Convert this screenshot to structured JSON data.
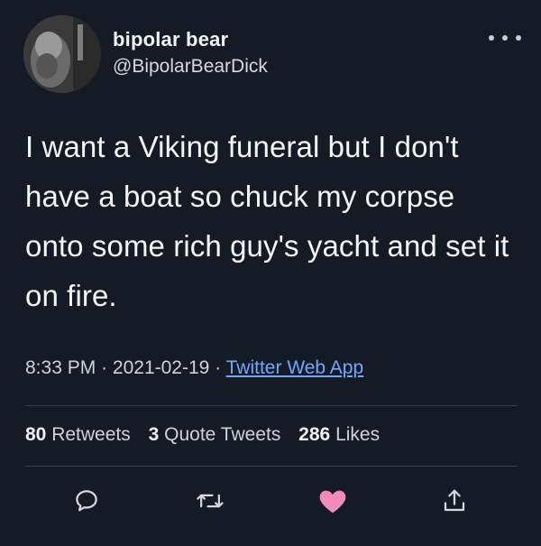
{
  "author": {
    "display_name": "bipolar bear",
    "handle": "@BipolarBearDick"
  },
  "tweet": {
    "text": "I want a Viking funeral but I don't have a boat so chuck my corpse onto some rich guy's yacht and set it on fire.",
    "time": "8:33 PM",
    "date": "2021-02-19",
    "separator": "·",
    "source": "Twitter Web App"
  },
  "stats": {
    "retweets_count": "80",
    "retweets_label": "Retweets",
    "quote_count": "3",
    "quote_label": "Quote Tweets",
    "likes_count": "286",
    "likes_label": "Likes"
  },
  "icons": {
    "more": "more-options-icon",
    "reply": "reply-icon",
    "retweet": "retweet-icon",
    "like": "heart-icon",
    "share": "share-icon"
  },
  "colors": {
    "background": "#151b25",
    "link": "#6ea8ff",
    "like": "#f28bb8",
    "text": "#f5f5f5",
    "muted": "#cfd3d7"
  }
}
